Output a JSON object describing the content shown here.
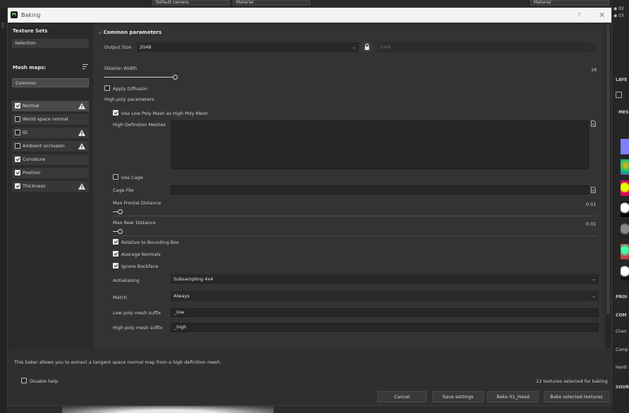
{
  "background": {
    "camera_label": "Default camera",
    "material_label": "Material",
    "material_label_right": "Material",
    "right_items": [
      "02",
      "03"
    ],
    "right_labels": [
      "LAYE",
      "MES",
      "PROI",
      "COM",
      "Chan",
      "Comp",
      "Hardi",
      "SOUR"
    ]
  },
  "window": {
    "title": "Baking",
    "app_icon": "Pt",
    "help_label": "?",
    "close_label": "✕"
  },
  "left_panel": {
    "texture_sets_header": "Texture Sets",
    "selection_label": "Selection",
    "mesh_maps_header": "Mesh maps:",
    "common_label": "Common",
    "mesh_maps": [
      {
        "label": "Normal",
        "checked": true,
        "warning": true,
        "active": true
      },
      {
        "label": "World space normal",
        "checked": false,
        "warning": false,
        "active": false
      },
      {
        "label": "ID",
        "checked": false,
        "warning": true,
        "active": false
      },
      {
        "label": "Ambient occlusion",
        "checked": false,
        "warning": true,
        "active": false
      },
      {
        "label": "Curvature",
        "checked": true,
        "warning": false,
        "active": false
      },
      {
        "label": "Position",
        "checked": true,
        "warning": false,
        "active": false
      },
      {
        "label": "Thickness",
        "checked": true,
        "warning": true,
        "active": false
      }
    ]
  },
  "common_parameters": {
    "header": "Common parameters",
    "output_size_label": "Output Size",
    "output_size_value": "2048",
    "output_size_locked_value": "2048",
    "dilation_width_label": "Dilation Width",
    "dilation_width_value": "16",
    "apply_diffusion_label": "Apply Diffusion",
    "apply_diffusion_checked": false,
    "high_poly_header": "High poly parameters",
    "use_low_poly_label": "Use Low Poly Mesh as High Poly Mesh",
    "use_low_poly_checked": true,
    "high_def_meshes_label": "High Definition Meshes",
    "use_cage_label": "Use Cage",
    "use_cage_checked": false,
    "cage_file_label": "Cage File",
    "cage_file_value": "",
    "max_frontal_label": "Max Frontal Distance",
    "max_frontal_value": "0.01",
    "max_rear_label": "Max Rear Distance",
    "max_rear_value": "0.01",
    "relative_bbox_label": "Relative to Bounding Box",
    "relative_bbox_checked": true,
    "average_normals_label": "Average Normals",
    "average_normals_checked": true,
    "ignore_backface_label": "Ignore Backface",
    "ignore_backface_checked": true,
    "antialiasing_label": "Antialiasing",
    "antialiasing_value": "Subsampling 4x4",
    "match_label": "Match",
    "match_value": "Always",
    "low_suffix_label": "Low poly mesh suffix",
    "low_suffix_value": "_low",
    "high_suffix_label": "High poly mesh suffix",
    "high_suffix_value": "_high"
  },
  "footer": {
    "help_text": "This baker allows you to extract a tangent space normal map from a high definition mesh.",
    "disable_help_label": "Disable help",
    "textures_selected": "12 textures selected for baking",
    "cancel_label": "Cancel",
    "save_settings_label": "Save settings",
    "bake_head_label": "Bake 01_Head",
    "bake_selected_label": "Bake selected textures"
  },
  "colors": {
    "dialog_bg": "#2f2f2f",
    "panel_bg": "#333333",
    "field_bg": "#262626",
    "titlebar_bg": "#f4f4f4"
  }
}
